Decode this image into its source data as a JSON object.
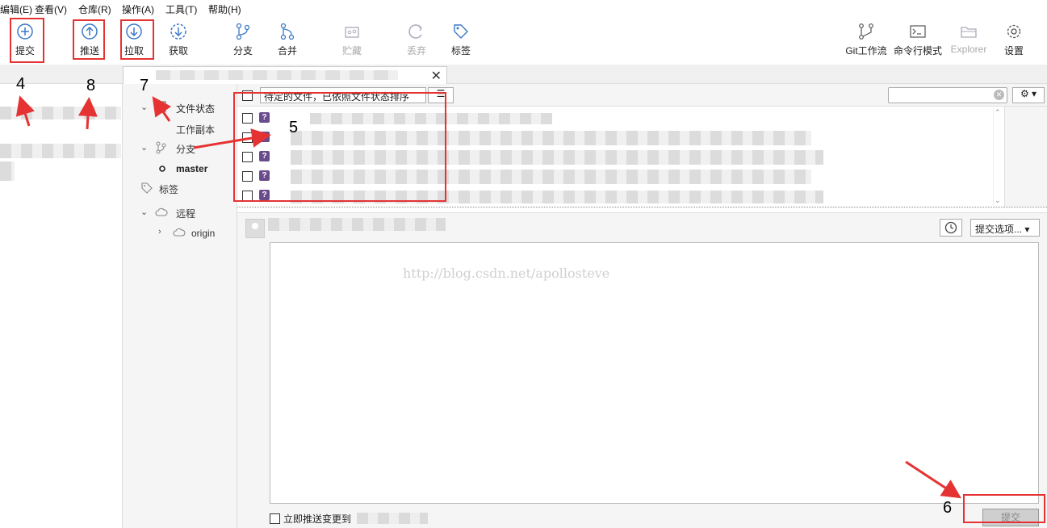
{
  "menu": [
    "编辑(E)",
    "查看(V)",
    "仓库(R)",
    "操作(A)",
    "工具(T)",
    "帮助(H)"
  ],
  "toolbar": {
    "commit": "提交",
    "push": "推送",
    "pull": "拉取",
    "fetch": "获取",
    "branch": "分支",
    "merge": "合并",
    "stash": "贮藏",
    "discard": "丢弃",
    "tag": "标签",
    "gitflow": "Git工作流",
    "terminal": "命令行模式",
    "explorer": "Explorer",
    "settings": "设置"
  },
  "tab": {
    "close": "✕"
  },
  "sidebar": {
    "file_status": "文件状态",
    "working_copy": "工作副本",
    "branches": "分支",
    "branch_master": "master",
    "tags": "标签",
    "remotes": "远程",
    "remote_origin": "origin"
  },
  "files": {
    "sort_label": "待定的文件，已依照文件状态排序",
    "view_icon": "☰",
    "gear": "⚙",
    "status_badge": "?",
    "count": 5
  },
  "commit": {
    "options": "提交选项...",
    "watermark": "http://blog.csdn.net/apollosteve",
    "push_immediately": "立即推送变更到",
    "submit": "提交"
  },
  "annotations": [
    "4",
    "8",
    "7",
    "5",
    "6"
  ],
  "colors": {
    "annotation_red": "#e53333",
    "untracked_badge": "#6a4c8c",
    "toolbar_icon": "#3c78c8"
  }
}
